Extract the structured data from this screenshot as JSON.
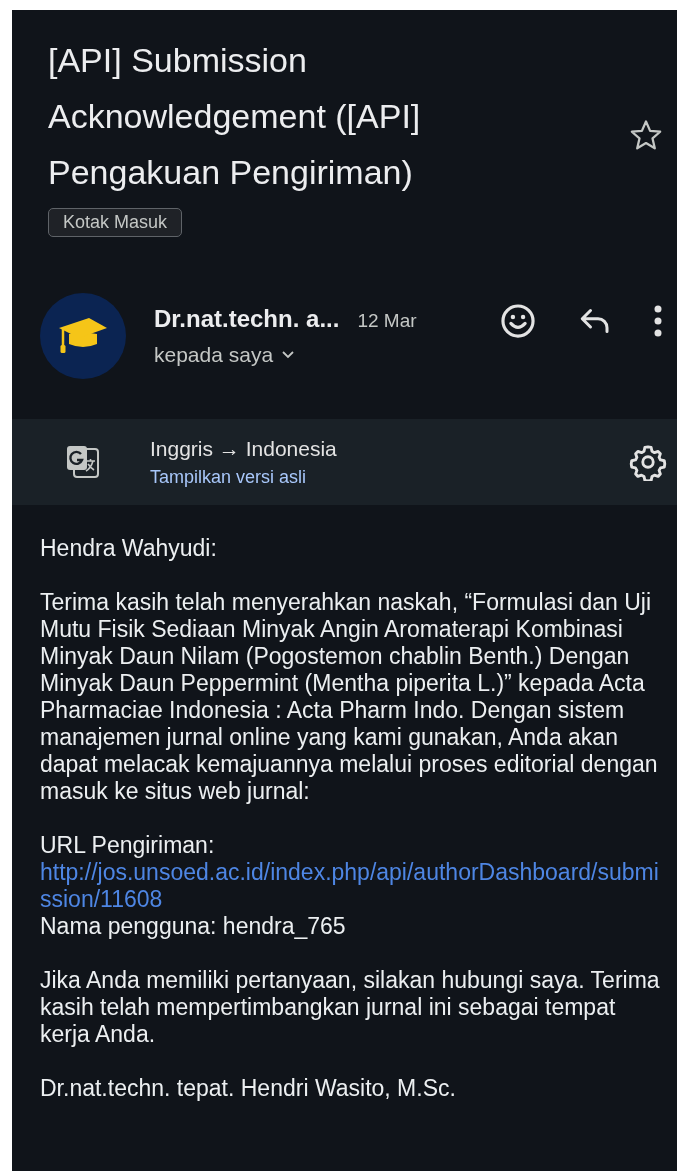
{
  "subject": {
    "title": "[API] Submission Acknowledgement ([API] Pengakuan Pengiriman)",
    "starred": false,
    "label": "Kotak Masuk"
  },
  "sender": {
    "name": "Dr.nat.techn. a...",
    "date": "12 Mar",
    "recipient": "kepada saya"
  },
  "translation": {
    "languages": "Inggris → Indonesia",
    "show_original": "Tampilkan versi asli"
  },
  "body": {
    "paragraphs": [
      {
        "lines": [
          {
            "kind": "text",
            "text": "Hendra Wahyudi:"
          }
        ]
      },
      {
        "lines": [
          {
            "kind": "text",
            "text": "Terima kasih telah menyerahkan naskah, “Formulasi dan Uji Mutu Fisik Sediaan Minyak Angin Aromaterapi Kombinasi Minyak Daun Nilam (Pogostemon chablin Benth.) Dengan Minyak Daun Peppermint (Mentha piperita L.)” kepada Acta Pharmaciae Indonesia : Acta Pharm Indo. Dengan sistem manajemen jurnal online yang kami gunakan, Anda akan dapat melacak kemajuannya melalui proses editorial dengan masuk ke situs web jurnal:"
          }
        ]
      },
      {
        "lines": [
          {
            "kind": "text",
            "text": "URL Pengiriman:"
          },
          {
            "kind": "link",
            "text": "http://jos.unsoed.ac.id/index.php/api/authorDashboard/submission/11608"
          },
          {
            "kind": "text",
            "text": "Nama pengguna: hendra_765"
          }
        ]
      },
      {
        "lines": [
          {
            "kind": "text",
            "text": "Jika Anda memiliki pertanyaan, silakan hubungi saya. Terima kasih telah mempertimbangkan jurnal ini sebagai tempat kerja Anda."
          }
        ]
      },
      {
        "lines": [
          {
            "kind": "text",
            "text": "Dr.nat.techn. tepat. Hendri Wasito, M.Sc."
          }
        ]
      }
    ]
  }
}
